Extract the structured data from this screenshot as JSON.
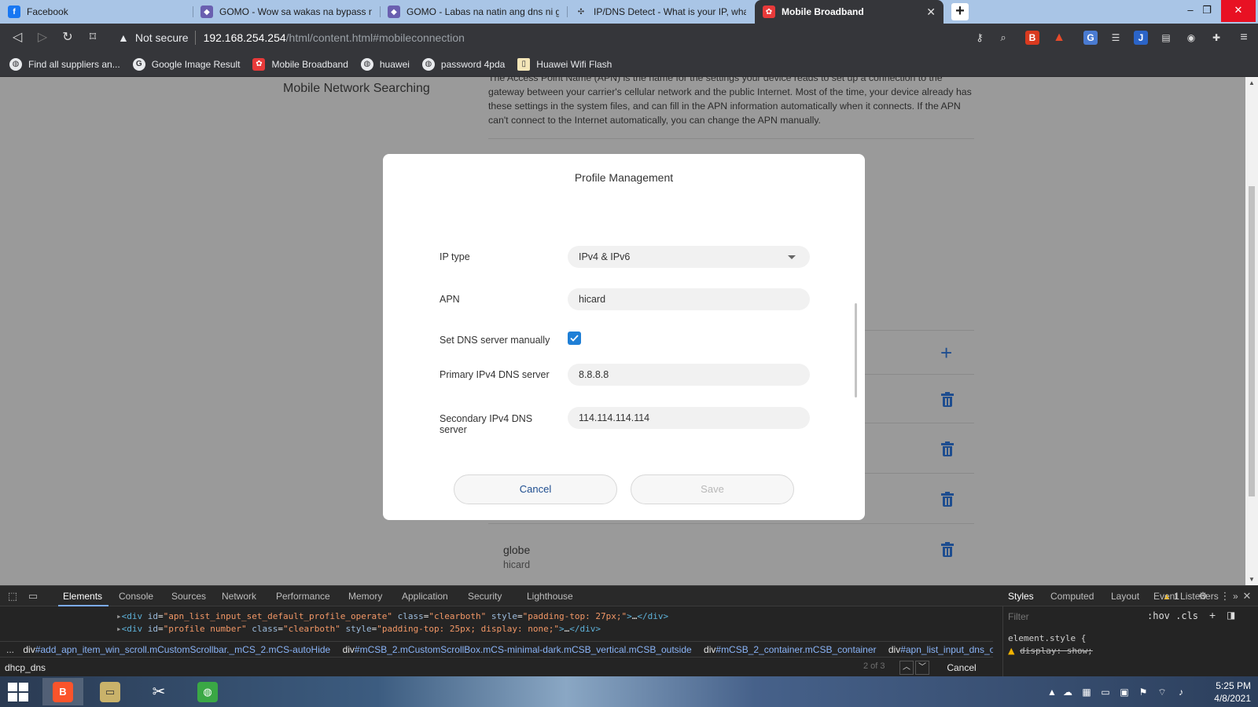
{
  "browser": {
    "tabs": [
      {
        "title": "Facebook",
        "icon": "facebook-icon",
        "active": false
      },
      {
        "title": "GOMO - Wow sa wakas na bypass na",
        "icon": "shield-icon",
        "active": false
      },
      {
        "title": "GOMO - Labas na natin ang dns ni go",
        "icon": "shield-icon",
        "active": false
      },
      {
        "title": "IP/DNS Detect - What is your IP, what",
        "icon": "dns-detect-icon",
        "active": false
      },
      {
        "title": "Mobile Broadband",
        "icon": "huawei-icon",
        "active": true
      }
    ],
    "new_tab_label": "+",
    "window_controls": {
      "minimize": "–",
      "restore": "❐",
      "close": "✕"
    },
    "security_label": "Not secure",
    "url_host": "192.168.254.254",
    "url_path": "/html/content.html#mobileconnection",
    "bookmarks": [
      {
        "label": "Find all suppliers an...",
        "icon": "globe-icon"
      },
      {
        "label": "Google Image Result",
        "icon": "google-icon"
      },
      {
        "label": "Mobile Broadband",
        "icon": "huawei-icon"
      },
      {
        "label": "huawei",
        "icon": "globe-icon"
      },
      {
        "label": "password 4pda",
        "icon": "globe-icon"
      },
      {
        "label": "Huawei Wifi Flash",
        "icon": "document-icon"
      }
    ]
  },
  "page": {
    "left_title": "Mobile Network Searching",
    "apn_description": "The Access Point Name (APN) is the name for the settings your device reads to set up a connection to the gateway between your carrier's cellular network and the public Internet. Most of the time, your device already has these settings in the system files, and can fill in the APN information automatically when it connects. If the APN can't connect to the Internet automatically, you can change the APN manually.",
    "last_profile": {
      "name": "globe",
      "apn": "hicard"
    }
  },
  "modal": {
    "title": "Profile Management",
    "fields": {
      "ip_type": {
        "label": "IP type",
        "value": "IPv4 & IPv6"
      },
      "apn": {
        "label": "APN",
        "value": "hicard"
      },
      "dns_manual": {
        "label": "Set DNS server manually",
        "checked": true
      },
      "primary_dns": {
        "label": "Primary IPv4 DNS server",
        "value": "8.8.8.8"
      },
      "secondary_dns": {
        "label": "Secondary IPv4 DNS server",
        "value": "114.114.114.114"
      }
    },
    "cancel_label": "Cancel",
    "save_label": "Save"
  },
  "devtools": {
    "tabs": [
      "Elements",
      "Console",
      "Sources",
      "Network",
      "Performance",
      "Memory",
      "Application",
      "Security",
      "Lighthouse"
    ],
    "active_tab": "Elements",
    "warning_count": "1",
    "dom_lines": [
      {
        "tag": "div",
        "id": "apn_list_input_set_default_profile_operate",
        "class": "clearboth",
        "style": "padding-top: 27px;"
      },
      {
        "tag": "div",
        "id": "profile_number",
        "class": "clearboth",
        "style": "padding-top: 25px; display: none;"
      }
    ],
    "breadcrumbs": [
      {
        "tag": "div",
        "rest": "#add_apn_item_win_scroll.mCustomScrollbar._mCS_2.mCS-autoHide"
      },
      {
        "tag": "div",
        "rest": "#mCSB_2.mCustomScrollBox.mCS-minimal-dark.mCSB_vertical.mCSB_outside"
      },
      {
        "tag": "div",
        "rest": "#mCSB_2_container.mCSB_container"
      },
      {
        "tag": "div",
        "rest": "#apn_list_input_dns_operate"
      }
    ],
    "breadcrumb_prefix": "...",
    "breadcrumb_more": "...",
    "search_value": "dhcp_dns",
    "match_count": "2 of 3",
    "search_cancel_label": "Cancel",
    "styles_tabs": [
      "Styles",
      "Computed",
      "Layout",
      "Event Listeners"
    ],
    "styles_filter_placeholder": "Filter",
    "styles_hov": ":hov .cls",
    "element_style_rule": "element.style {",
    "element_style_prop": "display: show;"
  },
  "taskbar": {
    "time": "5:25 PM",
    "date": "4/8/2021"
  },
  "colors": {
    "accent": "#1f7fd6",
    "link_blue": "#1e4d8f",
    "overlay_gray": "#9a9a9a"
  }
}
